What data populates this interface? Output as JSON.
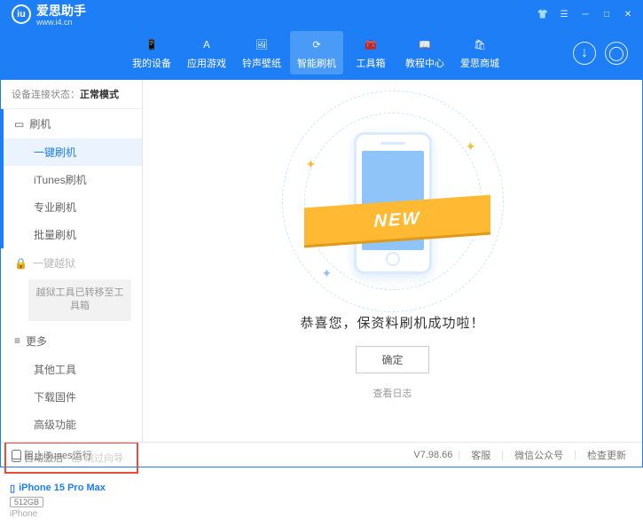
{
  "app": {
    "name": "爱思助手",
    "site": "www.i4.cn",
    "logo_letter": "iu"
  },
  "window_controls": {
    "menu_icon": "☰"
  },
  "nav": {
    "items": [
      {
        "label": "我的设备"
      },
      {
        "label": "应用游戏"
      },
      {
        "label": "铃声壁纸"
      },
      {
        "label": "智能刷机"
      },
      {
        "label": "工具箱"
      },
      {
        "label": "教程中心"
      },
      {
        "label": "爱思商城"
      }
    ]
  },
  "sidebar": {
    "conn_label": "设备连接状态：",
    "conn_value": "正常模式",
    "flash": {
      "head": "刷机",
      "items": [
        "一键刷机",
        "iTunes刷机",
        "专业刷机",
        "批量刷机"
      ]
    },
    "jailbreak": {
      "head": "一键越狱",
      "note": "越狱工具已转移至工具箱"
    },
    "more": {
      "head": "更多",
      "items": [
        "其他工具",
        "下载固件",
        "高级功能"
      ]
    },
    "checks": {
      "auto_activate": "自动激活",
      "skip_guide": "跳过向导"
    },
    "device": {
      "name": "iPhone 15 Pro Max",
      "storage": "512GB",
      "type": "iPhone"
    }
  },
  "main": {
    "ribbon": "NEW",
    "success": "恭喜您，保资料刷机成功啦！",
    "ok": "确定",
    "view_log": "查看日志"
  },
  "status": {
    "block_itunes": "阻止iTunes运行",
    "version": "V7.98.66",
    "links": [
      "客服",
      "微信公众号",
      "检查更新"
    ]
  }
}
